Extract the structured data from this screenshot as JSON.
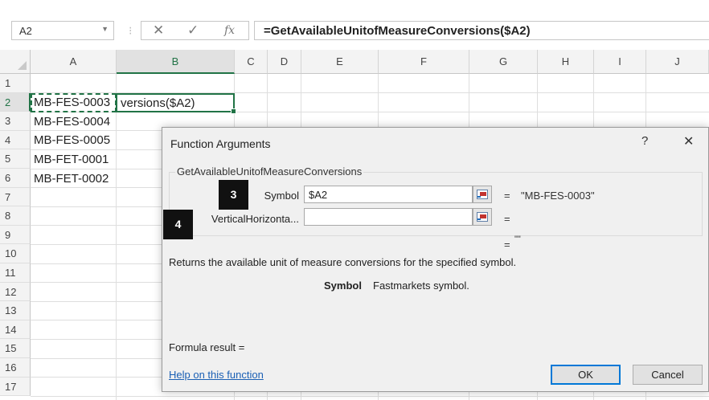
{
  "formula_bar": {
    "name_box": "A2",
    "formula": "=GetAvailableUnitofMeasureConversions($A2)"
  },
  "columns": [
    "A",
    "B",
    "C",
    "D",
    "E",
    "F",
    "G",
    "H",
    "I",
    "J"
  ],
  "rows": [
    "1",
    "2",
    "3",
    "4",
    "5",
    "6",
    "7",
    "8",
    "9",
    "10",
    "11",
    "12",
    "13",
    "14",
    "15",
    "16",
    "17"
  ],
  "cells": {
    "A2": "MB-FES-0003",
    "B2": "versions($A2)",
    "A3": "MB-FES-0004",
    "A4": "MB-FES-0005",
    "A5": "MB-FET-0001",
    "A6": "MB-FET-0002"
  },
  "dialog": {
    "title": "Function Arguments",
    "help_glyph": "?",
    "close_glyph": "✕",
    "function_name": "GetAvailableUnitofMeasureConversions",
    "args": [
      {
        "label": "Symbol",
        "value": "$A2",
        "equals": "=",
        "result": "\"MB-FES-0003\""
      },
      {
        "label": "VerticalHorizonta...",
        "value": "",
        "equals": "=",
        "result": ""
      }
    ],
    "function_result_equals": "=",
    "function_result": "\"\"",
    "description": "Returns the available unit of measure conversions for the specified symbol.",
    "param_label": "Symbol",
    "param_description": "Fastmarkets symbol.",
    "formula_result": "Formula result =",
    "help_link": "Help on this function",
    "ok_label": "OK",
    "cancel_label": "Cancel"
  },
  "callouts": [
    "3",
    "4"
  ]
}
